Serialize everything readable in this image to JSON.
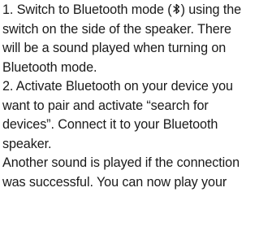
{
  "instructions": {
    "step1": {
      "line1_before_icon": "1. Switch to Bluetooth mode (",
      "line1_after_icon": ") using the",
      "icon": "bluetooth-icon",
      "line2": "switch on the side of the speaker. There",
      "line3": "will be a sound played when turning on",
      "line4": "Bluetooth mode."
    },
    "step2": {
      "line1": "2. Activate Bluetooth on your device you",
      "line2": "want to pair and activate “search for",
      "line3": "devices”. Connect it to your Bluetooth",
      "line4": "speaker."
    },
    "note": {
      "line1": "Another sound is played if the connection",
      "line2": "was successful. You can now play your"
    }
  }
}
